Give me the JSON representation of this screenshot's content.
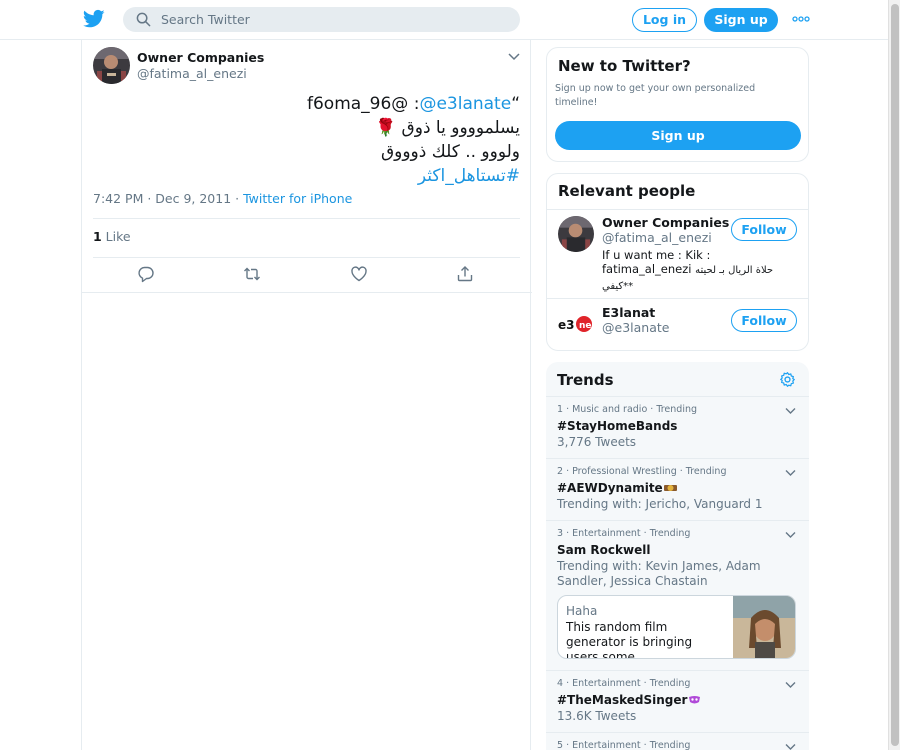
{
  "header": {
    "search_placeholder": "Search Twitter",
    "login_label": "Log in",
    "signup_label": "Sign up",
    "brand_color": "#1da1f2"
  },
  "tweet": {
    "author_name": "Owner Companies",
    "author_handle": "@fatima_al_enezi",
    "text_line1_prefix": "f6oma_96@ :",
    "text_line1_mention": "@e3lanate",
    "text_line1_quote": "“",
    "text_line2": "يسلموووو يا ذوق 🌹",
    "text_line3": "ولووو .. كلك ذوووق",
    "text_line4_hashtag": "#تستاهل_اكثر",
    "time": "7:42 PM · Dec 9, 2011 · ",
    "source": "Twitter for iPhone",
    "like_count": "1",
    "like_label": " Like",
    "icons": [
      "reply-icon",
      "retweet-icon",
      "like-icon",
      "share-icon"
    ]
  },
  "new_to_twitter": {
    "title": "New to Twitter?",
    "description": "Sign up now to get your own personalized timeline!",
    "button": "Sign up"
  },
  "relevant_people": {
    "title": "Relevant people",
    "people": [
      {
        "name": "Owner Companies",
        "handle": "@fatima_al_enezi",
        "follow": "Follow",
        "bio_latin": "If u want me : Kik : fatima_al_enezi ",
        "bio_arabic": "حلاة الريال بـ لحيته ",
        "bio_tail": "كيفي**"
      },
      {
        "name": "E3lanat",
        "handle": "@e3lanate",
        "follow": "Follow"
      }
    ]
  },
  "trends": {
    "title": "Trends",
    "items": [
      {
        "context": "1 · Music and radio · Trending",
        "name": "#StayHomeBands",
        "sub": "3,776 Tweets"
      },
      {
        "context": "2 · Professional Wrestling · Trending",
        "name": "#AEWDynamite",
        "sub": "Trending with: Jericho, Vanguard 1"
      },
      {
        "context": "3 · Entertainment · Trending",
        "name": "Sam Rockwell",
        "sub": "Trending with: Kevin James, Adam Sandler, Jessica Chastain",
        "card": {
          "source": "Haha",
          "headline": "This random film generator is bringing users some ..."
        }
      },
      {
        "context": "4 · Entertainment · Trending",
        "name": "#TheMaskedSinger",
        "sub": "13.6K Tweets"
      },
      {
        "context": "5 · Entertainment · Trending",
        "name": "",
        "sub": ""
      }
    ]
  }
}
